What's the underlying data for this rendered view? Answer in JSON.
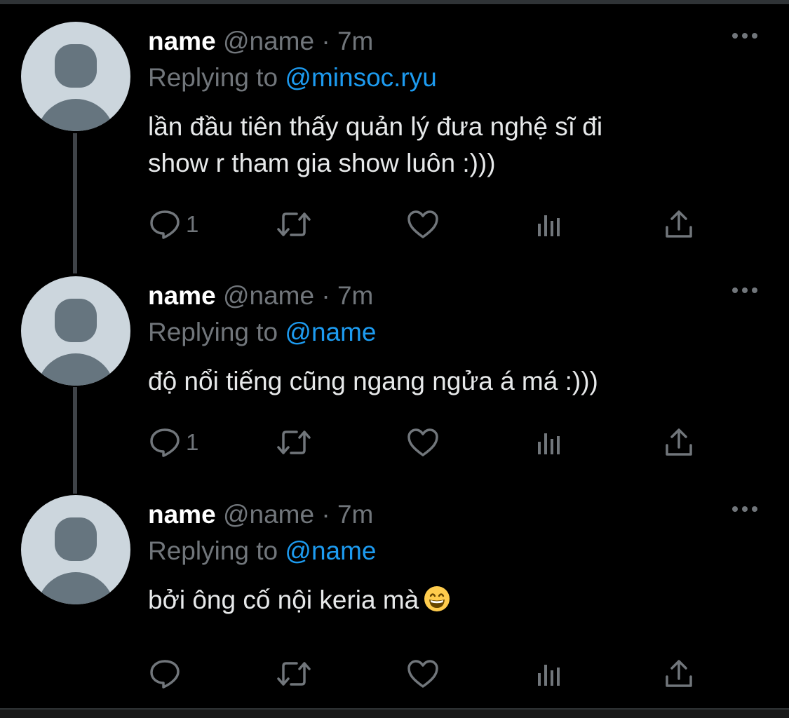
{
  "tweets": [
    {
      "display_name": "name",
      "handle": "@name",
      "separator": "·",
      "time": "7m",
      "replying_prefix": "Replying to",
      "replying_to": "@minsoc.ryu",
      "text_line1": "lần đầu tiên thấy quản lý đưa nghệ sĩ đi",
      "text_line2": "show r tham gia show luôn :)))",
      "reply_count": "1"
    },
    {
      "display_name": "name",
      "handle": "@name",
      "separator": "·",
      "time": "7m",
      "replying_prefix": "Replying to",
      "replying_to": "@name",
      "text_line1": "độ nổi tiếng cũng ngang ngửa á má :)))",
      "reply_count": "1"
    },
    {
      "display_name": "name",
      "handle": "@name",
      "separator": "·",
      "time": "7m",
      "replying_prefix": "Replying to",
      "replying_to": "@name",
      "text_line1": "bởi ông cố nội keria mà",
      "emoji": "grinning-face-with-smiling-eyes",
      "reply_count": ""
    }
  ],
  "icons": {
    "reply": "reply-icon",
    "retweet": "retweet-icon",
    "like": "heart-icon",
    "views": "analytics-icon",
    "share": "share-icon",
    "more": "more-icon"
  },
  "colors": {
    "background": "#000000",
    "mention": "#1d9bf0",
    "muted": "#71767b",
    "text": "#e7e9ea",
    "avatar_bg": "#ccd6dd",
    "avatar_fg": "#66757f"
  }
}
